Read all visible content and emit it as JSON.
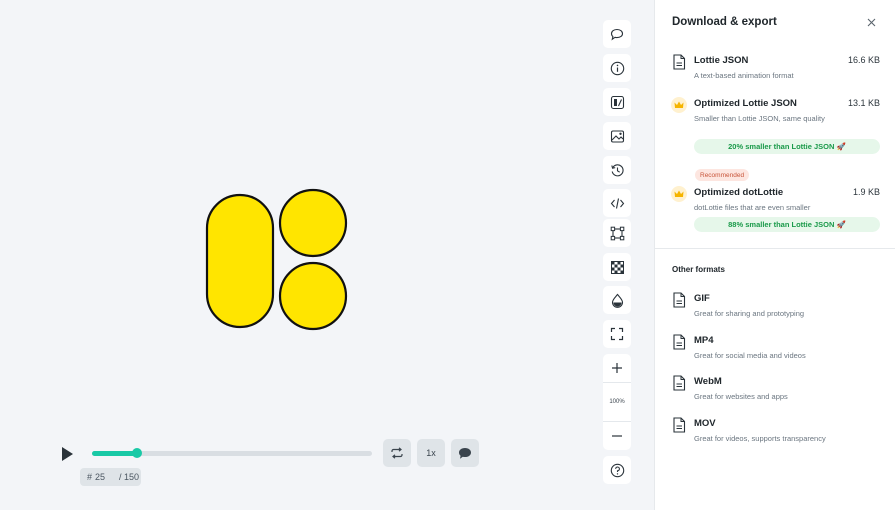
{
  "player": {
    "progress": 0.16,
    "frame_prefix": "#",
    "current_frame": "25",
    "total_frames": "/ 150",
    "speed_label": "1x"
  },
  "toolbar": {
    "items": [
      "comment-icon",
      "info-icon",
      "theme-icon",
      "background-image-icon",
      "history-icon",
      "code-icon",
      "bounding-box-icon",
      "transparency-grid-icon",
      "color-drop-icon",
      "fullscreen-icon"
    ],
    "zoom_level": "100%",
    "help_icon": "help-icon"
  },
  "panel": {
    "title": "Download & export",
    "formats": [
      {
        "name": "Lottie JSON",
        "size": "16.6 KB",
        "desc": "A text-based animation format"
      },
      {
        "name": "Optimized Lottie JSON",
        "size": "13.1 KB",
        "desc": "Smaller than Lottie JSON, same quality",
        "badge": "20% smaller than Lottie JSON 🚀"
      },
      {
        "name": "Optimized dotLottie",
        "size": "1.9 KB",
        "desc": "dotLottie files that are even smaller",
        "badge": "88% smaller than Lottie JSON 🚀",
        "tag": "Recommended"
      }
    ],
    "other_label": "Other formats",
    "other": [
      {
        "name": "GIF",
        "desc": "Great for sharing and prototyping"
      },
      {
        "name": "MP4",
        "desc": "Great for social media and videos"
      },
      {
        "name": "WebM",
        "desc": "Great for websites and apps"
      },
      {
        "name": "MOV",
        "desc": "Great for videos, supports transparency"
      }
    ]
  },
  "colors": {
    "accent": "#19c9a6",
    "shape_fill": "#ffe500",
    "badge_green": "#1a9a4a",
    "crown": "#f5b400"
  }
}
